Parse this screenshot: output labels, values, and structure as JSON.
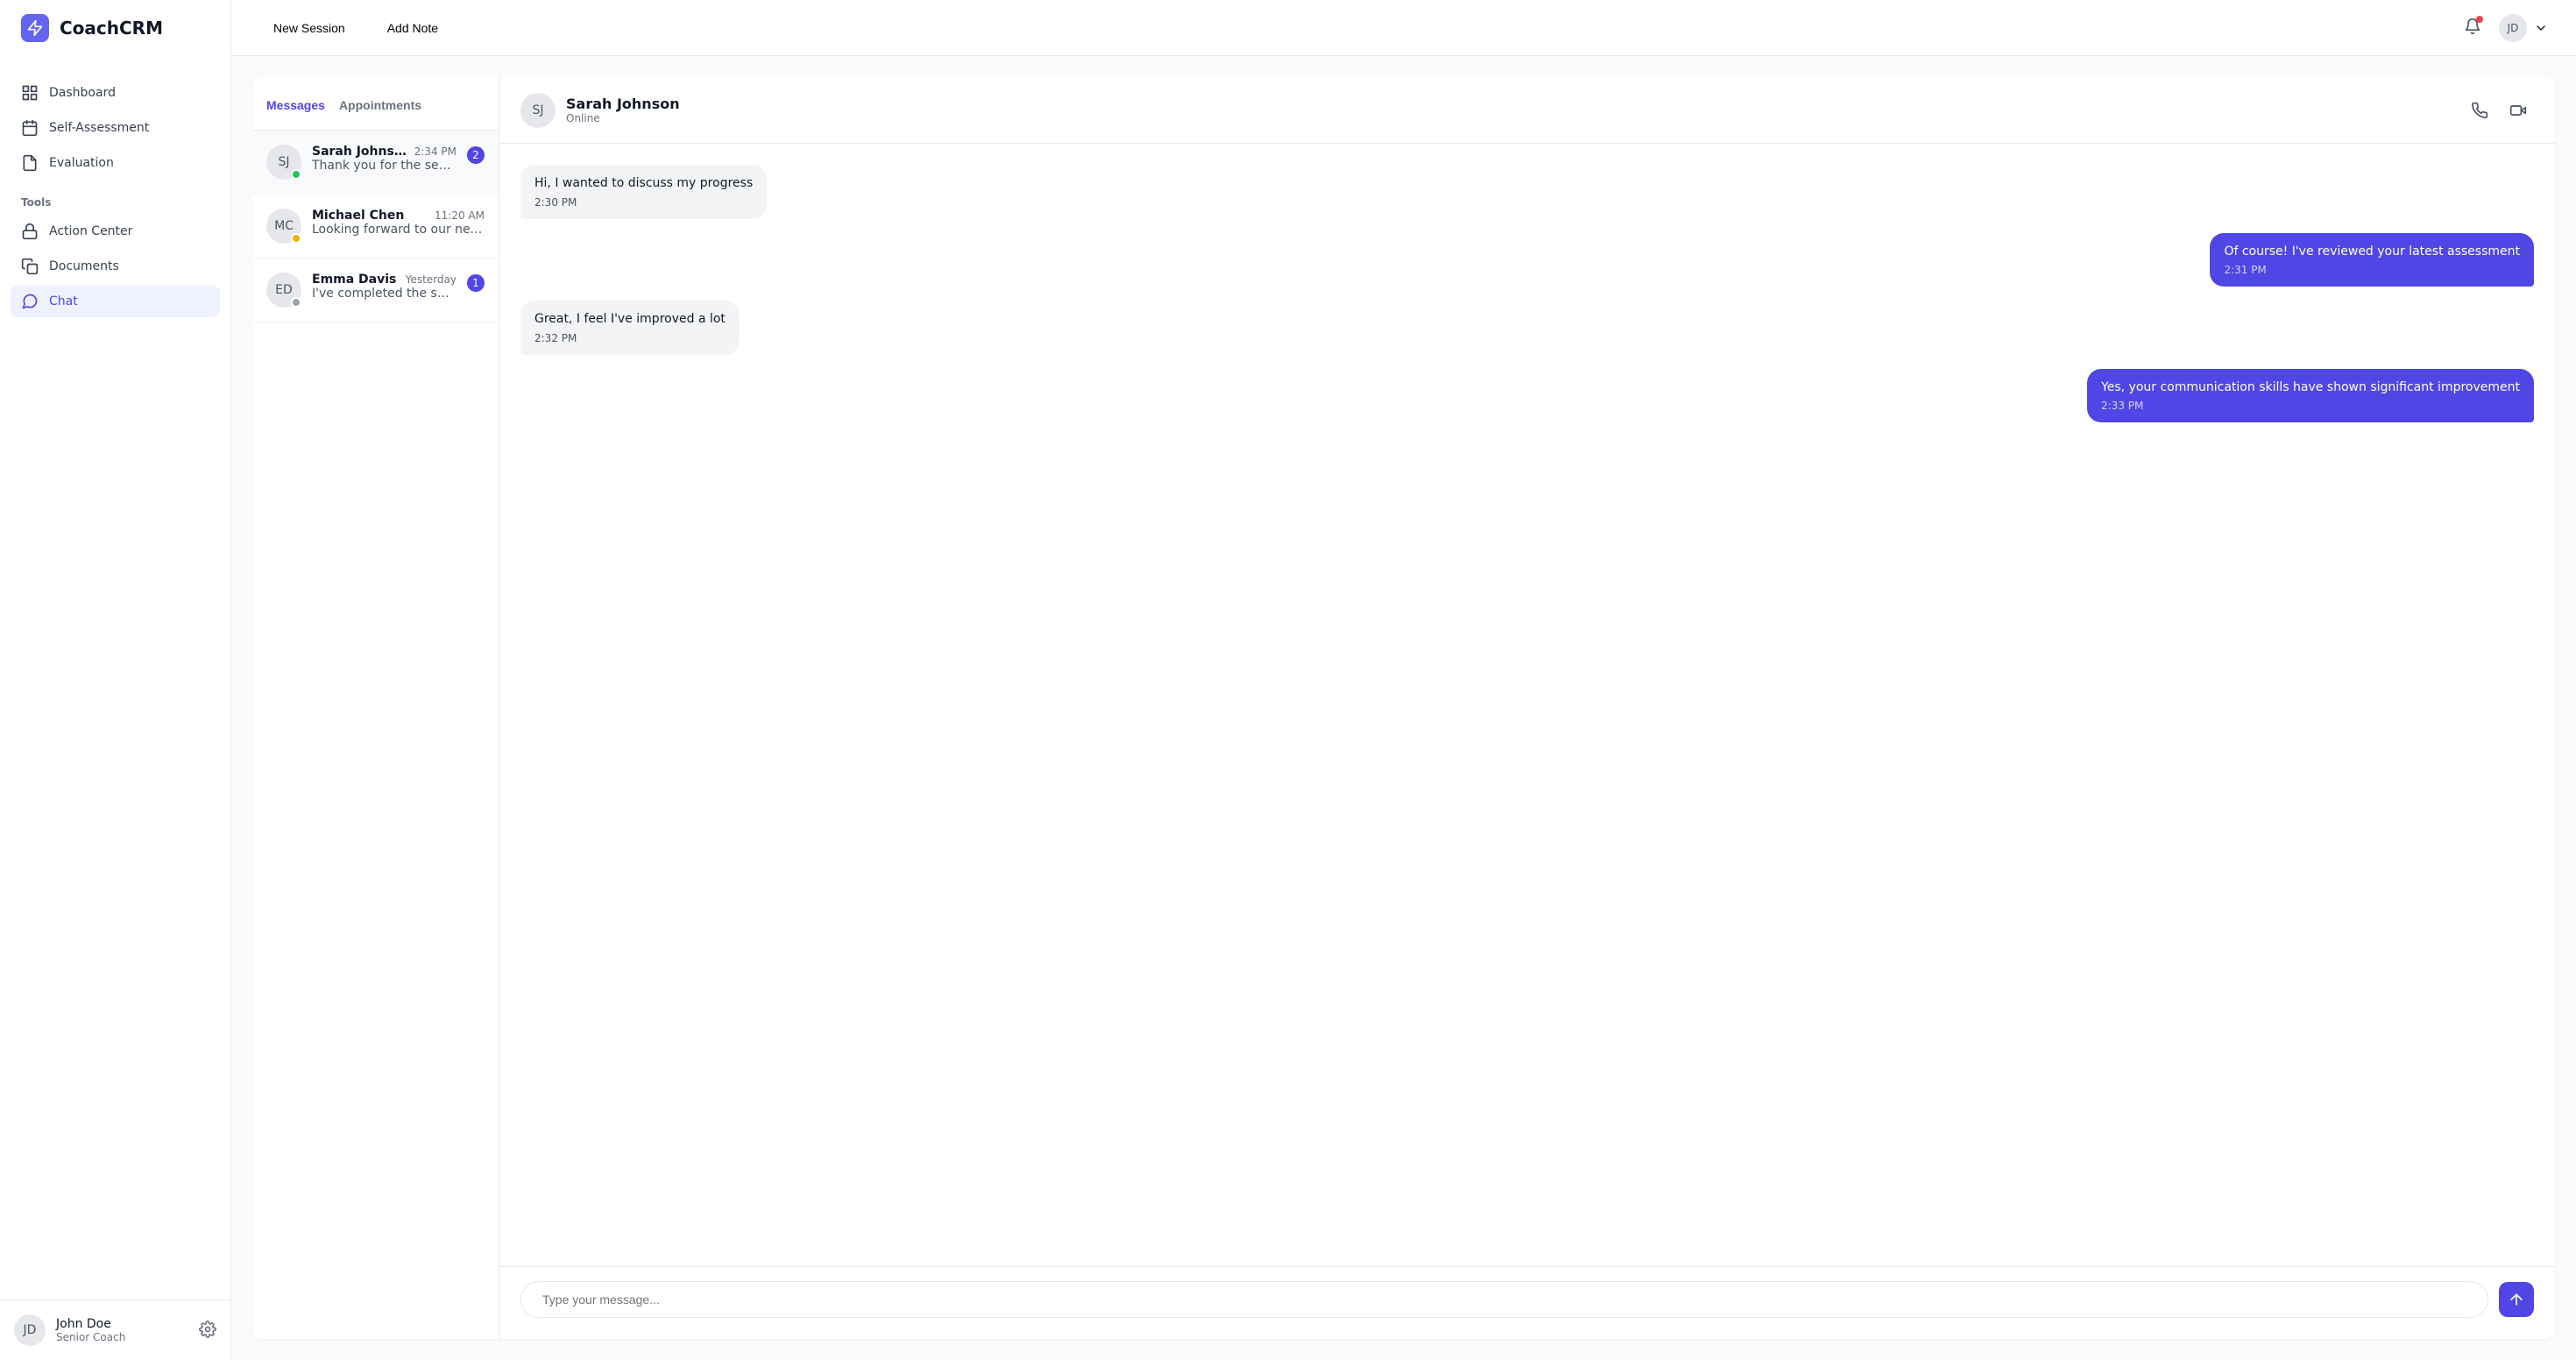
{
  "brand": {
    "name": "CoachCRM"
  },
  "topbar": {
    "new_session": "New Session",
    "add_note": "Add Note",
    "user_initials": "JD"
  },
  "sidebar": {
    "items": [
      {
        "label": "Dashboard"
      },
      {
        "label": "Self-Assessment"
      },
      {
        "label": "Evaluation"
      }
    ],
    "tools_label": "Tools",
    "tools": [
      {
        "label": "Action Center"
      },
      {
        "label": "Documents"
      },
      {
        "label": "Chat"
      }
    ],
    "footer": {
      "initials": "JD",
      "name": "John Doe",
      "role": "Senior Coach"
    }
  },
  "tabs": {
    "messages": "Messages",
    "appointments": "Appointments"
  },
  "conversations": [
    {
      "initials": "SJ",
      "name": "Sarah Johnson",
      "time": "2:34 PM",
      "preview": "Thank you for the session today!",
      "unread": "2",
      "status": "online"
    },
    {
      "initials": "MC",
      "name": "Michael Chen",
      "time": "11:20 AM",
      "preview": "Looking forward to our next appointment",
      "unread": "",
      "status": "away"
    },
    {
      "initials": "ED",
      "name": "Emma Davis",
      "time": "Yesterday",
      "preview": "I've completed the self-assessment",
      "unread": "1",
      "status": "offline"
    }
  ],
  "active_chat": {
    "initials": "SJ",
    "name": "Sarah Johnson",
    "status": "Online"
  },
  "messages": [
    {
      "text": "Hi, I wanted to discuss my progress",
      "time": "2:30 PM",
      "dir": "received"
    },
    {
      "text": "Of course! I've reviewed your latest assessment",
      "time": "2:31 PM",
      "dir": "sent"
    },
    {
      "text": "Great, I feel I've improved a lot",
      "time": "2:32 PM",
      "dir": "received"
    },
    {
      "text": "Yes, your communication skills have shown significant improvement",
      "time": "2:33 PM",
      "dir": "sent"
    }
  ],
  "input": {
    "placeholder": "Type your message..."
  }
}
